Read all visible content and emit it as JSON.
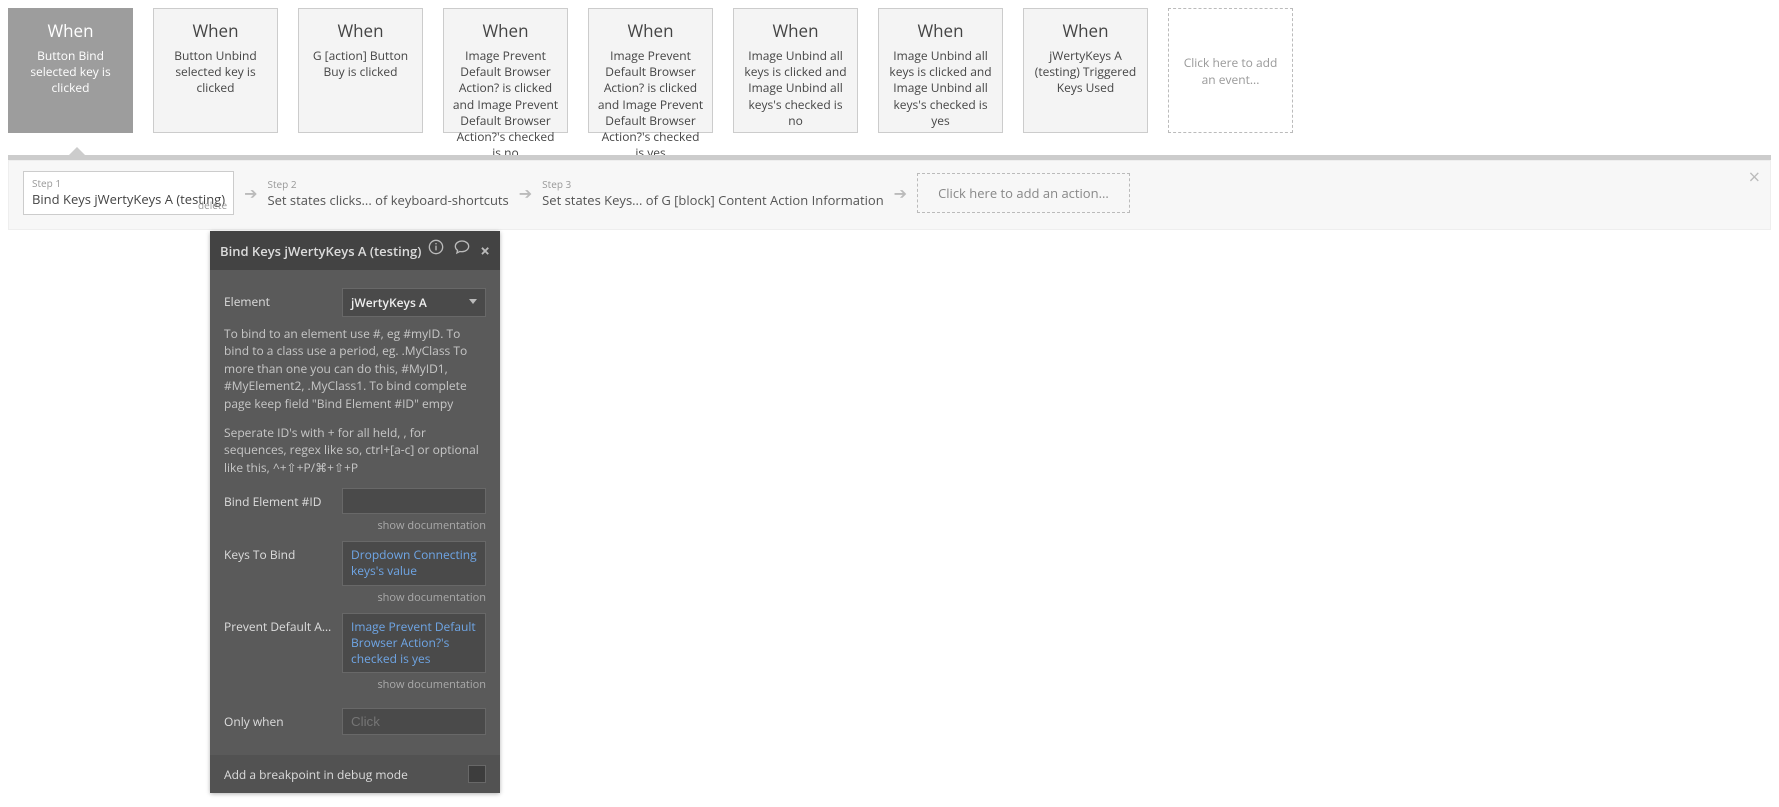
{
  "events": {
    "when_label": "When",
    "items": [
      {
        "desc": "Button Bind selected key is clicked",
        "selected": true
      },
      {
        "desc": "Button Unbind selected key is clicked"
      },
      {
        "desc": "G [action] Button Buy is clicked"
      },
      {
        "desc": "Image Prevent Default Browser Action? is clicked and Image Prevent Default Browser Action?'s checked is no"
      },
      {
        "desc": "Image Prevent Default Browser Action? is clicked and Image Prevent Default Browser Action?'s checked is yes"
      },
      {
        "desc": "Image Unbind all keys is clicked and Image Unbind all keys's checked is no"
      },
      {
        "desc": "Image Unbind all keys is clicked and Image Unbind all keys's checked is yes"
      },
      {
        "desc": "jWertyKeys A (testing) Triggered Keys Used"
      }
    ],
    "add_label": "Click here to add an event..."
  },
  "steps": {
    "items": [
      {
        "n": "Step 1",
        "text": "Bind Keys jWertyKeys A (testing)",
        "boxed": true,
        "delete": "delete"
      },
      {
        "n": "Step 2",
        "text": "Set states clicks... of keyboard-shortcuts"
      },
      {
        "n": "Step 3",
        "text": "Set states Keys... of G [block] Content Action Information"
      }
    ],
    "add_label": "Click here to add an action..."
  },
  "panel": {
    "title": "Bind Keys jWertyKeys A (testing)",
    "element_label": "Element",
    "element_value": "jWertyKeys A",
    "help1": "To bind to an element use #, eg #myID. To bind to a class use a period, eg. .MyClass To more than one you can do this, #MyID1, #MyElement2, .MyClass1. To bind complete page keep field \"Bind Element #ID\" empy",
    "help2": "Seperate ID's with + for all held, , for sequences, regex like so, ctrl+[a-c] or optional like this, ^+⇧+P/⌘+⇧+P",
    "bind_label": "Bind Element #ID",
    "keys_label": "Keys To Bind",
    "keys_value": "Dropdown Connecting keys's value",
    "prevent_label": "Prevent Default Actio",
    "prevent_value": "Image Prevent Default Browser Action?'s checked is yes",
    "onlywhen_label": "Only when",
    "onlywhen_placeholder": "Click",
    "doc_label": "show documentation",
    "breakpoint_label": "Add a breakpoint in debug mode"
  }
}
